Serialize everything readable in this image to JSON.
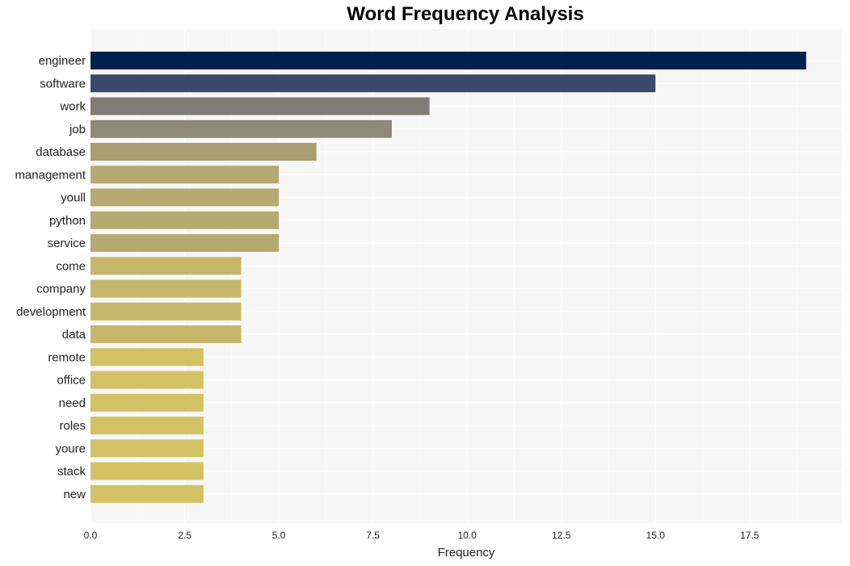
{
  "chart_data": {
    "type": "bar",
    "orientation": "horizontal",
    "title": "Word Frequency Analysis",
    "xlabel": "Frequency",
    "ylabel": "",
    "xlim": [
      0,
      19.95
    ],
    "xticks": [
      0.0,
      2.5,
      5.0,
      7.5,
      10.0,
      12.5,
      15.0,
      17.5
    ],
    "xtick_labels": [
      "0.0",
      "2.5",
      "5.0",
      "7.5",
      "10.0",
      "12.5",
      "15.0",
      "17.5"
    ],
    "grid": true,
    "categories": [
      "engineer",
      "software",
      "work",
      "job",
      "database",
      "management",
      "youll",
      "python",
      "service",
      "come",
      "company",
      "development",
      "data",
      "remote",
      "office",
      "need",
      "roles",
      "youre",
      "stack",
      "new"
    ],
    "values": [
      19,
      15,
      9,
      8,
      6,
      5,
      5,
      5,
      5,
      4,
      4,
      4,
      4,
      3,
      3,
      3,
      3,
      3,
      3,
      3
    ],
    "colors": [
      "#00204d",
      "#3a496b",
      "#7f7c75",
      "#8d8a77",
      "#a99e72",
      "#b6a971",
      "#b6a971",
      "#b6a971",
      "#b6a971",
      "#c6b66a",
      "#c6b66a",
      "#c6b66a",
      "#c6b66a",
      "#d3c263",
      "#d3c263",
      "#d3c263",
      "#d3c263",
      "#d3c263",
      "#d3c263",
      "#d3c263"
    ],
    "plot_background": "#f7f7f7",
    "gridline_color": "#ffffff"
  }
}
